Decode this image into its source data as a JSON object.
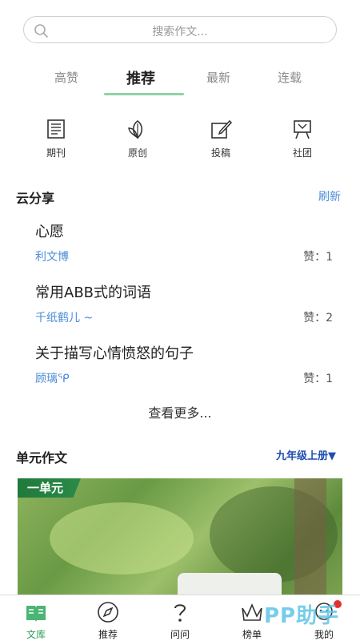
{
  "search": {
    "placeholder": "搜索作文..."
  },
  "tabs": [
    {
      "label": "高赞"
    },
    {
      "label": "推荐"
    },
    {
      "label": "最新"
    },
    {
      "label": "连载"
    }
  ],
  "active_tab": "推荐",
  "categories": [
    {
      "label": "期刊",
      "icon": "journal-icon"
    },
    {
      "label": "原创",
      "icon": "leaf-icon"
    },
    {
      "label": "投稿",
      "icon": "pen-edit-icon"
    },
    {
      "label": "社团",
      "icon": "club-icon"
    }
  ],
  "cloud_share": {
    "title": "云分享",
    "refresh_label": "刷新",
    "items": [
      {
        "title": "心愿",
        "author": "利文博",
        "likes": "赞：1"
      },
      {
        "title": "常用ABB式的词语",
        "author": "千纸鹤儿 ~",
        "likes": "赞：2"
      },
      {
        "title": "关于描写心情愤怒的句子",
        "author": "顾璃ᕿ",
        "likes": "赞：1"
      }
    ],
    "more_label": "查看更多..."
  },
  "unit_essay": {
    "title": "单元作文",
    "grade_select": "九年级上册▼",
    "banner_tag": "一单元"
  },
  "bottom_nav": [
    {
      "label": "文库",
      "icon": "book-icon",
      "active": true
    },
    {
      "label": "推荐",
      "icon": "compass-icon",
      "active": false
    },
    {
      "label": "问问",
      "icon": "question-icon",
      "active": false
    },
    {
      "label": "榜单",
      "icon": "crown-icon",
      "active": false
    },
    {
      "label": "我的",
      "icon": "profile-icon",
      "active": false
    }
  ],
  "watermark": "PP助手",
  "colors": {
    "accent_green": "#2d9c5a",
    "link_blue": "#4a8cd8",
    "tab_underline": "#8fd3a6"
  }
}
